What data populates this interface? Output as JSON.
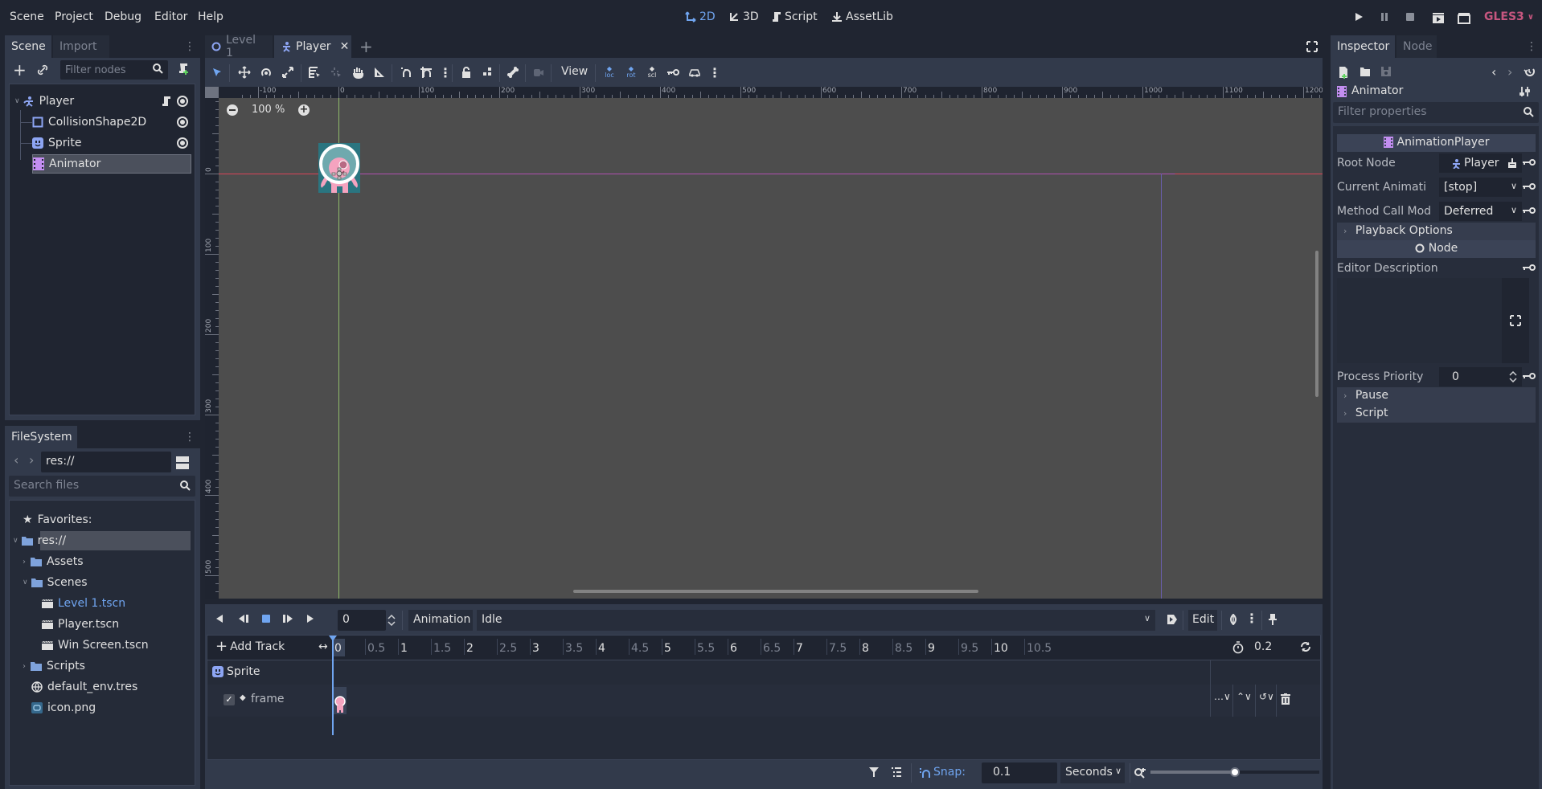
{
  "menubar": {
    "menus": [
      "Scene",
      "Project",
      "Debug",
      "Editor",
      "Help"
    ],
    "workspaces": [
      {
        "label": "2D",
        "icon": "2d-icon",
        "active": true
      },
      {
        "label": "3D",
        "icon": "3d-icon",
        "active": false
      },
      {
        "label": "Script",
        "icon": "script-icon",
        "active": false
      },
      {
        "label": "AssetLib",
        "icon": "assetlib-icon",
        "active": false
      }
    ],
    "renderer": "GLES3",
    "accent_color": "#70a5f0",
    "renderer_color": "#c6567f"
  },
  "scene_dock": {
    "tabs": [
      "Scene",
      "Import"
    ],
    "filter_placeholder": "Filter nodes",
    "tree": [
      {
        "name": "Player",
        "icon": "kinematic-body-icon",
        "has_script": true,
        "visible": true,
        "depth": 0
      },
      {
        "name": "CollisionShape2D",
        "icon": "collision-shape-icon",
        "visible": true,
        "depth": 1
      },
      {
        "name": "Sprite",
        "icon": "sprite-icon",
        "visible": true,
        "depth": 1
      },
      {
        "name": "Animator",
        "icon": "animation-player-icon",
        "selected": true,
        "depth": 1
      }
    ]
  },
  "filesystem": {
    "tab": "FileSystem",
    "path": "res://",
    "search_placeholder": "Search files",
    "favorites_label": "Favorites:",
    "items": [
      {
        "name": "res://",
        "type": "folder",
        "depth": 0,
        "expanded": true,
        "selected": true
      },
      {
        "name": "Assets",
        "type": "folder",
        "depth": 1,
        "expanded": false
      },
      {
        "name": "Scenes",
        "type": "folder",
        "depth": 1,
        "expanded": true
      },
      {
        "name": "Level 1.tscn",
        "type": "scene",
        "depth": 2,
        "highlight": true
      },
      {
        "name": "Player.tscn",
        "type": "scene",
        "depth": 2
      },
      {
        "name": "Win Screen.tscn",
        "type": "scene",
        "depth": 2
      },
      {
        "name": "Scripts",
        "type": "folder",
        "depth": 1,
        "expanded": false
      },
      {
        "name": "default_env.tres",
        "type": "environment",
        "depth": 1
      },
      {
        "name": "icon.png",
        "type": "image",
        "depth": 1
      }
    ]
  },
  "editor_tabs": [
    {
      "label": "Level 1",
      "icon": "node-icon",
      "active": false
    },
    {
      "label": "Player",
      "icon": "kinematic-body-icon",
      "active": true,
      "closable": true
    }
  ],
  "toolbar": {
    "view_label": "View",
    "keys": [
      "loc",
      "rot",
      "scl"
    ]
  },
  "viewport": {
    "zoom_label": "100 %",
    "ruler_x": [
      "-100",
      "0",
      "100",
      "200",
      "300",
      "400",
      "500",
      "600",
      "700",
      "800",
      "900",
      "1000",
      "1100",
      "1200"
    ],
    "ruler_y": [
      "0",
      "100",
      "200",
      "300",
      "400",
      "500"
    ]
  },
  "animation": {
    "time_value": "0",
    "animation_label": "Animation",
    "current_animation": "Idle",
    "edit_label": "Edit",
    "add_track_label": "Add Track",
    "timeline_marks": [
      "0",
      "0.5",
      "1",
      "1.5",
      "2",
      "2.5",
      "3",
      "3.5",
      "4",
      "4.5",
      "5",
      "5.5",
      "6",
      "6.5",
      "7",
      "7.5",
      "8",
      "8.5",
      "9",
      "9.5",
      "10",
      "10.5"
    ],
    "length_value": "0.2",
    "tracks": [
      {
        "node": "Sprite",
        "property": "frame",
        "enabled": true
      }
    ],
    "snap_label": "Snap:",
    "snap_value": "0.1",
    "snap_unit": "Seconds",
    "zoom_fraction": 0.5
  },
  "inspector": {
    "tabs": [
      "Inspector",
      "Node"
    ],
    "object_name": "Animator",
    "filter_placeholder": "Filter properties",
    "class_header": "AnimationPlayer",
    "properties": [
      {
        "label": "Root Node",
        "value": "Player"
      },
      {
        "label": "Current Animati",
        "value": "[stop]"
      },
      {
        "label": "Method Call Mod",
        "value": "Deferred"
      }
    ],
    "playback_section": "Playback Options",
    "node_header": "Node",
    "editor_description_label": "Editor Description",
    "process_priority_label": "Process Priority",
    "process_priority_value": "0",
    "sections": [
      "Pause",
      "Script"
    ]
  }
}
